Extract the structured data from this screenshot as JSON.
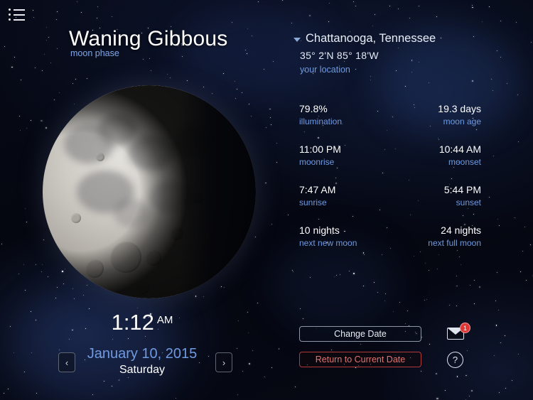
{
  "menu": {
    "icon": "list-menu-icon"
  },
  "header": {
    "phase_title": "Waning Gibbous",
    "phase_subtitle": "moon phase"
  },
  "location": {
    "name": "Chattanooga, Tennessee",
    "coordinates": "35° 2'N   85° 18'W",
    "note": "your location",
    "caret_icon": "caret-down-icon"
  },
  "stats": [
    {
      "value": "79.8%",
      "label": "illumination",
      "value_right": "19.3 days",
      "label_right": "moon age"
    },
    {
      "value": "11:00 PM",
      "label": "moonrise",
      "value_right": "10:44 AM",
      "label_right": "moonset"
    },
    {
      "value": "7:47 AM",
      "label": "sunrise",
      "value_right": "5:44 PM",
      "label_right": "sunset"
    },
    {
      "value": "10 nights",
      "label": "next new moon",
      "value_right": "24 nights",
      "label_right": "next full moon"
    }
  ],
  "clock": {
    "time": "1:12",
    "ampm": "AM"
  },
  "date": {
    "full": "January 10, 2015",
    "weekday": "Saturday",
    "prev_icon": "chevron-left-icon",
    "next_icon": "chevron-right-icon"
  },
  "buttons": {
    "change_date": "Change Date",
    "return_current": "Return to Current Date"
  },
  "icons": {
    "mail": "envelope-icon",
    "mail_badge": "1",
    "help": "?"
  },
  "colors": {
    "accent_blue": "#6f9ae0",
    "danger_red": "#e4736f",
    "badge_red": "#e03535",
    "text_white": "#ffffff"
  }
}
